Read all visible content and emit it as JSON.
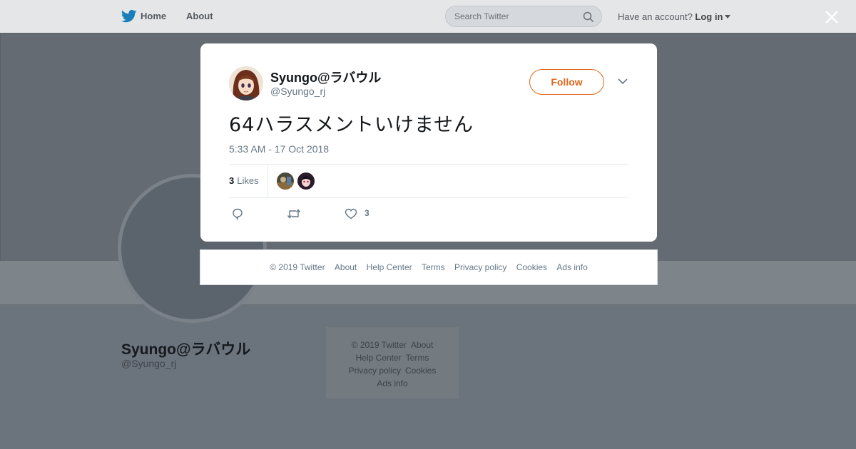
{
  "topbar": {
    "home_label": "Home",
    "about_label": "About",
    "search_placeholder": "Search Twitter",
    "account_prompt": "Have an account?",
    "login_label": "Log in"
  },
  "profile": {
    "name": "Syungo@ラバウル",
    "handle": "@Syungo_rj"
  },
  "background_footer": {
    "items": [
      "© 2019 Twitter",
      "About",
      "Help Center",
      "Terms",
      "Privacy policy",
      "Cookies",
      "Ads info"
    ]
  },
  "tweet": {
    "author_name": "Syungo@ラバウル",
    "author_handle": "@Syungo_rj",
    "follow_label": "Follow",
    "text": "64ハラスメントいけません",
    "timestamp": "5:33 AM - 17 Oct 2018",
    "likes_number": "3",
    "likes_label": "Likes",
    "like_count": "3"
  },
  "modal_footer": {
    "items": [
      "© 2019 Twitter",
      "About",
      "Help Center",
      "Terms",
      "Privacy policy",
      "Cookies",
      "Ads info"
    ]
  },
  "colors": {
    "follow_accent": "#e0671f",
    "twitter_blue": "#1da1f2",
    "overlay": "#6b737c"
  },
  "icons": {
    "logo": "twitter-bird-icon",
    "search": "search-icon",
    "close": "close-icon",
    "more": "chevron-down-icon",
    "reply": "reply-icon",
    "retweet": "retweet-icon",
    "like": "heart-icon"
  }
}
